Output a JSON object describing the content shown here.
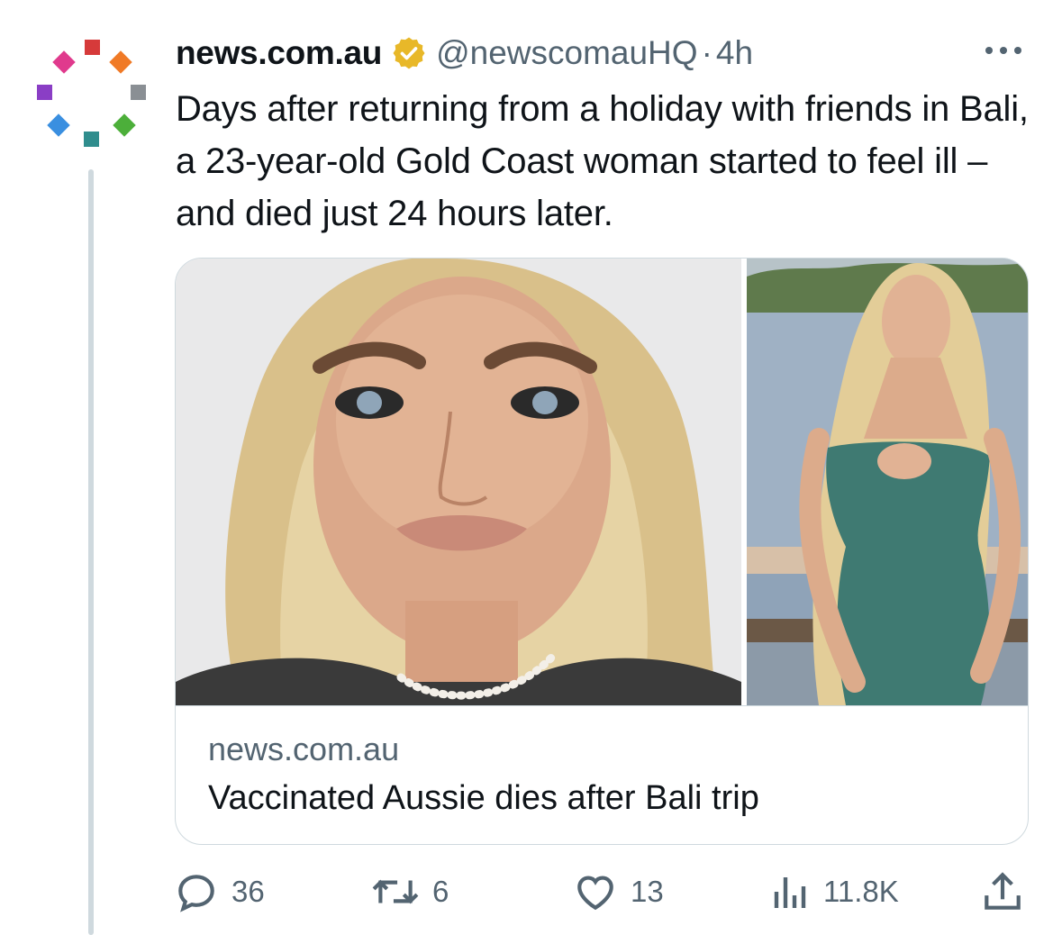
{
  "tweet": {
    "display_name": "news.com.au",
    "handle": "@newscomauHQ",
    "separator": "·",
    "time": "4h",
    "text": "Days after returning from a holiday with friends in Bali, a 23-year-old Gold Coast woman started to feel ill – and died just 24 hours later.",
    "verified_badge_color": "#e8b829"
  },
  "card": {
    "domain": "news.com.au",
    "title": "Vaccinated Aussie dies after Bali trip",
    "images": [
      "photo-portrait",
      "photo-full-body"
    ]
  },
  "actions": {
    "replies": "36",
    "reposts": "6",
    "likes": "13",
    "views": "11.8K"
  },
  "colors": {
    "text_primary": "#0f1419",
    "text_secondary": "#536471",
    "border": "#cfd9de",
    "logo_dots": [
      "#e03a8d",
      "#d63a3a",
      "#f07a26",
      "#8a3ec5",
      "#8a8f94",
      "#3a8fe0",
      "#2f8d8d",
      "#4caf3a"
    ]
  }
}
